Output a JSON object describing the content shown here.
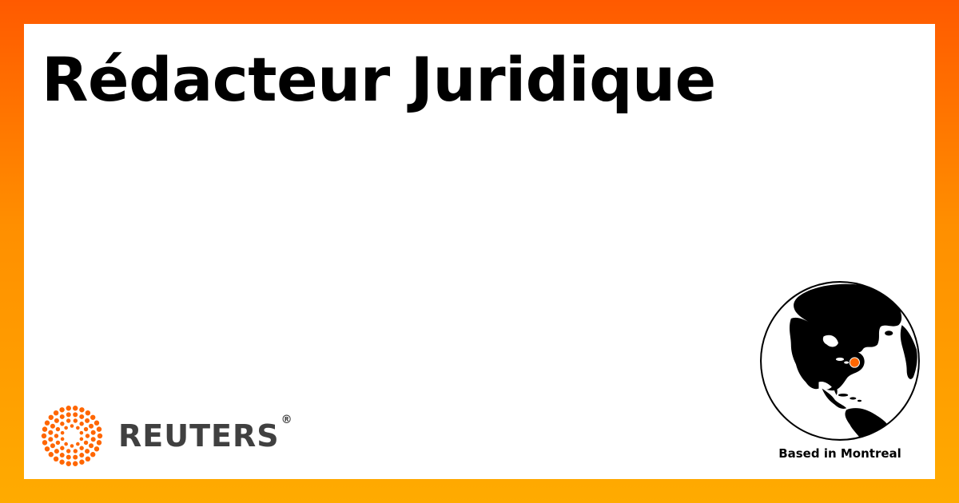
{
  "job": {
    "title": "Rédacteur Juridique"
  },
  "brand": {
    "name": "REUTERS",
    "registered_mark": "®",
    "logo_icon": "reuters-dot-ring-logo",
    "accent_color": "#ff6600",
    "wordmark_color": "#404040"
  },
  "location": {
    "label": "Based in Montreal",
    "globe_icon": "globe-americas-icon",
    "marker_color": "#ff6600"
  },
  "colors": {
    "frame_top": "#ff5a00",
    "frame_bottom": "#ffab00",
    "card_background": "#ffffff",
    "title_color": "#000000"
  }
}
